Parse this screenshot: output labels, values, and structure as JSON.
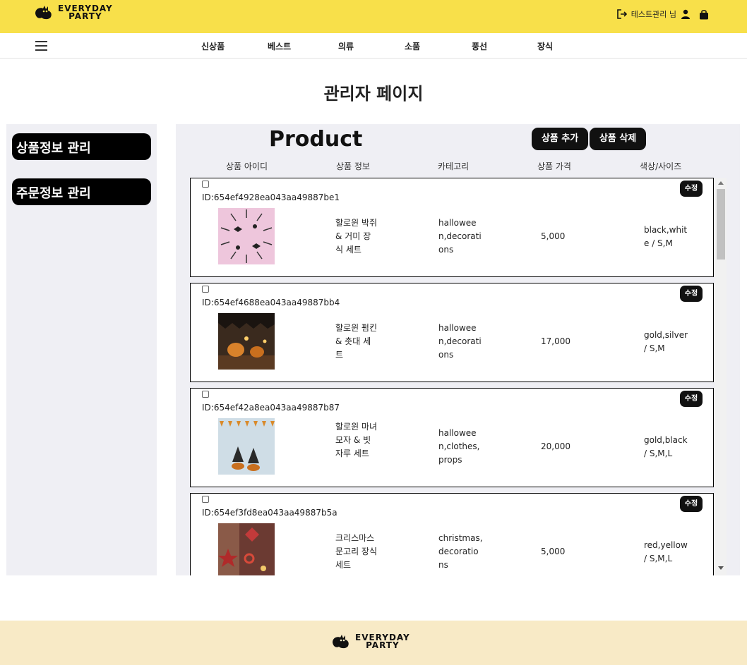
{
  "brand": {
    "line1": "EVERYDAY",
    "line2": "PARTY"
  },
  "header": {
    "user_name": "테스트관리 님",
    "icons": [
      "logout-icon",
      "user-icon",
      "shopping-bag-icon"
    ]
  },
  "nav": {
    "items": [
      {
        "label": "신상품"
      },
      {
        "label": "베스트"
      },
      {
        "label": "의류"
      },
      {
        "label": "소품"
      },
      {
        "label": "풍선"
      },
      {
        "label": "장식"
      }
    ]
  },
  "page_title": "관리자 페이지",
  "sidebar": {
    "items": [
      {
        "label": "상품정보 관리"
      },
      {
        "label": "주문정보 관리"
      }
    ]
  },
  "main": {
    "title": "Product",
    "add_button": "상품 추가",
    "delete_button": "상품 삭제",
    "columns": [
      "상품 아이디",
      "상품 정보",
      "카테고리",
      "상품 가격",
      "색상/사이즈"
    ],
    "edit_label": "수정",
    "products": [
      {
        "id": "ID:654ef4928ea043aa49887be1",
        "name": "할로윈 박쥐 & 거미 장식 세트",
        "category": "halloween,decorations",
        "price": "5,000",
        "color_size": "black,white / S,M",
        "thumb": "bats-on-pink"
      },
      {
        "id": "ID:654ef4688ea043aa49887bb4",
        "name": "할로윈 펌킨 & 촛대 세트",
        "category": "halloween,decorations",
        "price": "17,000",
        "color_size": "gold,silver / S,M",
        "thumb": "pumpkin-candles"
      },
      {
        "id": "ID:654ef42a8ea043aa49887b87",
        "name": "할로윈 마녀 모자 & 빗자루 세트",
        "category": "halloween,clothes,props",
        "price": "20,000",
        "color_size": "gold,black / S,M,L",
        "thumb": "witch-hats"
      },
      {
        "id": "ID:654ef3fd8ea043aa49887b5a",
        "name": "크리스마스 문고리 장식 세트",
        "category": "christmas,decorations",
        "price": "5,000",
        "color_size": "red,yellow / S,M,L",
        "thumb": "christmas-ornaments"
      }
    ]
  },
  "colors": {
    "header_bg": "#f8e04a",
    "footer_bg": "#f8eac6",
    "panel_bg": "#efeff4",
    "button_bg": "#111111"
  }
}
